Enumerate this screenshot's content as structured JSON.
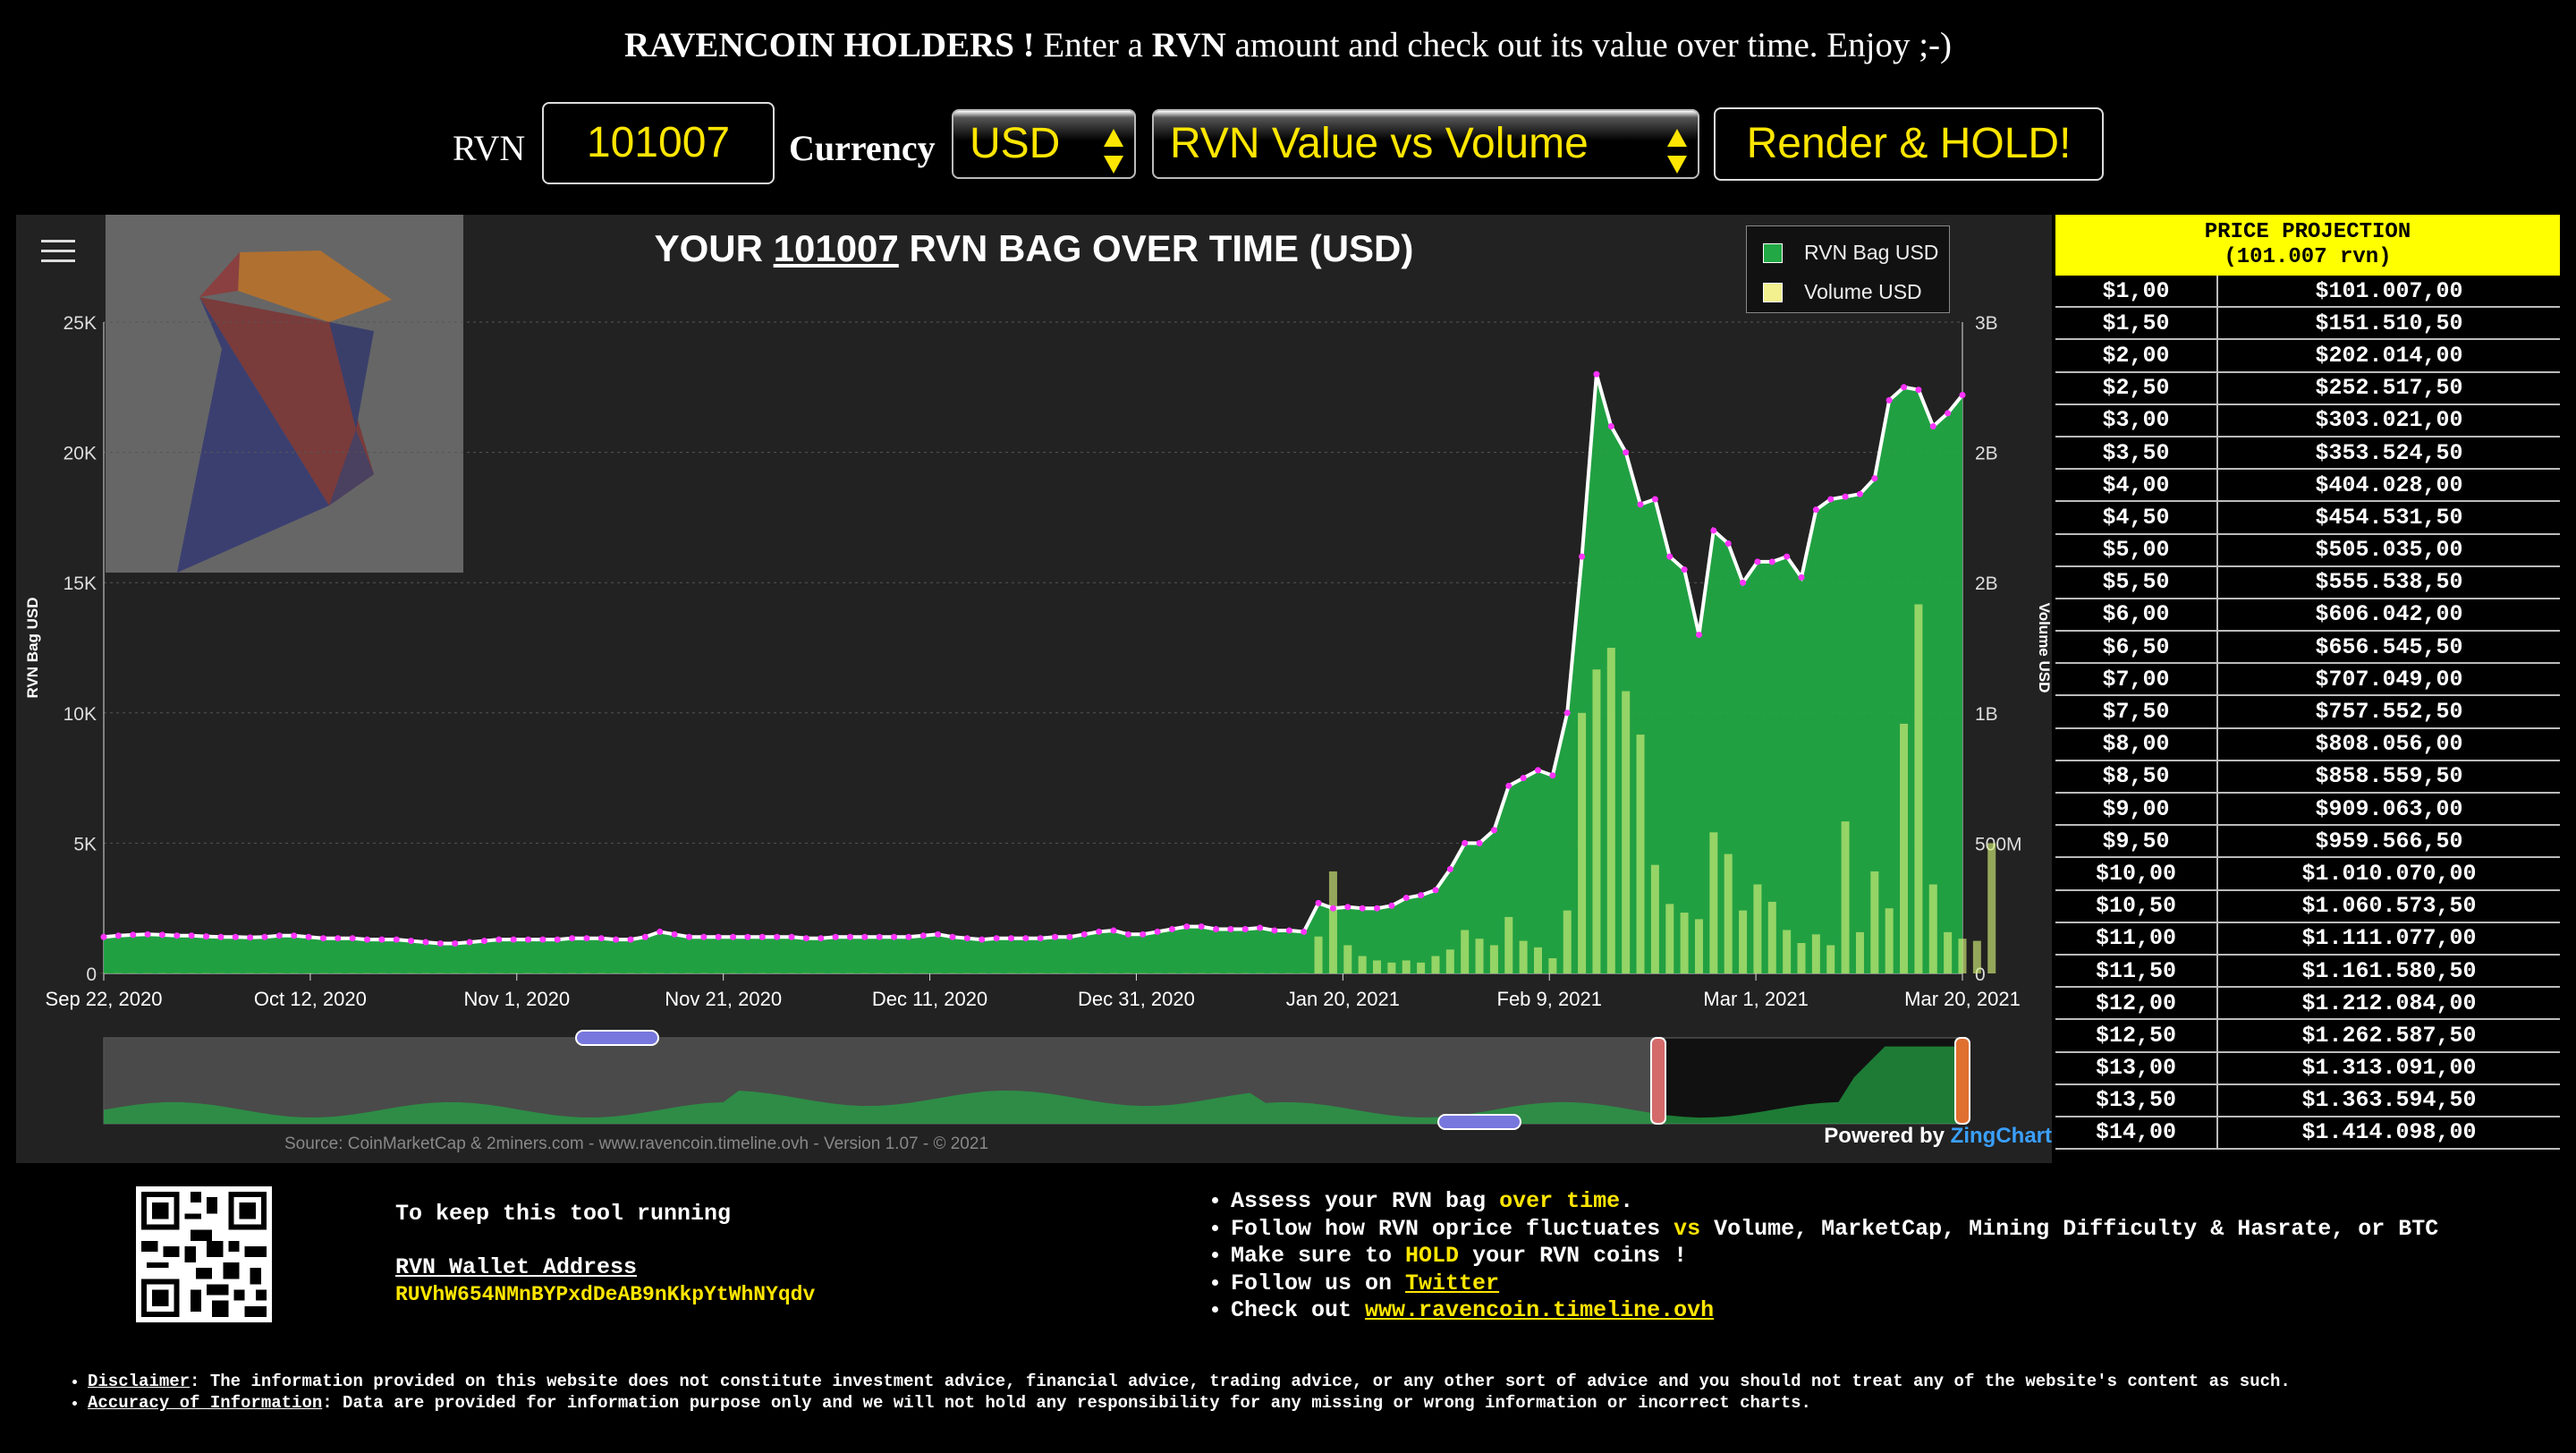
{
  "header": {
    "brand": "RAVENCOIN HOLDERS !",
    "text1": "Enter a",
    "rvn": "RVN",
    "text2": "amount and check out its value over time. Enjoy ;-)"
  },
  "controls": {
    "rvn_label": "RVN",
    "rvn_value": "101007",
    "currency_label": "Currency",
    "currency_value": "USD",
    "chart_value": "RVN Value vs Volume",
    "render_label": "Render & HOLD!"
  },
  "chart": {
    "title_pre": "YOUR",
    "title_amount": "101007",
    "title_post": "RVN BAG OVER TIME (USD)",
    "legend": [
      "RVN Bag USD",
      "Volume USD"
    ],
    "source": "Source: CoinMarketCap & 2miners.com - www.ravencoin.timeline.ovh - Version 1.07 - © 2021",
    "powered_pre": "Powered by",
    "powered_brand": "ZingChart",
    "ylabel": "RVN Bag USD",
    "y2label": "Volume USD",
    "yticks": [
      "0",
      "5K",
      "10K",
      "15K",
      "20K",
      "25K"
    ],
    "y2ticks": [
      "0",
      "500M",
      "1B",
      "2B",
      "2B",
      "3B"
    ],
    "xticks": [
      "Sep 22, 2020",
      "Oct 12, 2020",
      "Nov 1, 2020",
      "Nov 21, 2020",
      "Dec 11, 2020",
      "Dec 31, 2020",
      "Jan 20, 2021",
      "Feb 9, 2021",
      "Mar 1, 2021",
      "Mar 20, 2021"
    ],
    "colors": {
      "bag": "#22a845",
      "volume": "#d4f07a",
      "line": "#ffffff",
      "markers": "#ff33ff"
    }
  },
  "chart_data": {
    "type": "area",
    "title": "YOUR 101007 RVN BAG OVER TIME (USD)",
    "ylabel": "RVN Bag USD",
    "y2label": "Volume USD",
    "ylim": [
      0,
      25000
    ],
    "y2lim": [
      0,
      3000000000
    ],
    "x_start": "Sep 22, 2020",
    "x_end": "Mar 20, 2021",
    "series": [
      {
        "name": "RVN Bag USD",
        "values": [
          1400,
          1450,
          1480,
          1500,
          1480,
          1450,
          1450,
          1420,
          1400,
          1400,
          1380,
          1400,
          1450,
          1450,
          1400,
          1350,
          1350,
          1350,
          1300,
          1300,
          1300,
          1250,
          1200,
          1150,
          1150,
          1200,
          1250,
          1300,
          1300,
          1300,
          1300,
          1300,
          1350,
          1350,
          1350,
          1300,
          1300,
          1400,
          1600,
          1500,
          1400,
          1400,
          1400,
          1400,
          1400,
          1400,
          1400,
          1400,
          1350,
          1350,
          1400,
          1400,
          1400,
          1400,
          1400,
          1400,
          1450,
          1500,
          1400,
          1350,
          1300,
          1350,
          1350,
          1350,
          1350,
          1400,
          1400,
          1500,
          1600,
          1650,
          1500,
          1500,
          1600,
          1700,
          1800,
          1800,
          1700,
          1700,
          1700,
          1750,
          1650,
          1650,
          1600,
          2700,
          2500,
          2550,
          2500,
          2500,
          2600,
          2900,
          3000,
          3200,
          4000,
          5000,
          5000,
          5500,
          7200,
          7500,
          7800,
          7600,
          10000,
          16000,
          23000,
          21000,
          20000,
          18000,
          18200,
          16000,
          15500,
          13000,
          17000,
          16500,
          15000,
          15800,
          15800,
          16000,
          15200,
          17800,
          18200,
          18300,
          18400,
          19000,
          22000,
          22500,
          22400,
          21000,
          21500,
          22200
        ]
      },
      {
        "name": "Volume USD",
        "values": [
          1000000,
          1000000,
          1000000,
          1000000,
          1000000,
          1000000,
          1000000,
          1000000,
          1000000,
          1000000,
          1000000,
          1000000,
          1000000,
          1000000,
          1000000,
          1000000,
          1000000,
          1000000,
          1000000,
          1000000,
          1000000,
          1000000,
          1000000,
          1000000,
          1000000,
          1000000,
          1000000,
          1000000,
          1000000,
          1000000,
          1000000,
          1000000,
          1000000,
          1000000,
          1000000,
          1000000,
          1000000,
          1000000,
          1000000,
          1000000,
          1000000,
          1000000,
          1000000,
          1000000,
          1000000,
          1000000,
          1000000,
          1000000,
          1000000,
          1000000,
          1000000,
          1000000,
          1000000,
          1000000,
          1000000,
          1000000,
          1000000,
          1000000,
          1000000,
          1000000,
          1000000,
          1000000,
          1000000,
          1000000,
          1000000,
          1000000,
          1000000,
          1000000,
          1000000,
          1000000,
          1000000,
          1000000,
          1000000,
          1000000,
          1000000,
          1000000,
          1000000,
          1000000,
          1000000,
          1000000,
          1000000,
          1000000,
          1000000,
          170000000,
          470000000,
          130000000,
          80000000,
          60000000,
          50000000,
          60000000,
          50000000,
          80000000,
          110000000,
          200000000,
          160000000,
          130000000,
          260000000,
          150000000,
          120000000,
          70000000,
          290000000,
          1200000000,
          1400000000,
          1500000000,
          1300000000,
          1100000000,
          500000000,
          320000000,
          280000000,
          250000000,
          650000000,
          550000000,
          290000000,
          410000000,
          330000000,
          200000000,
          140000000,
          180000000,
          130000000,
          700000000,
          190000000,
          470000000,
          300000000,
          1150000000,
          1700000000,
          410000000,
          190000000,
          160000000,
          150000000,
          600000000
        ]
      }
    ]
  },
  "projection": {
    "title": "PRICE PROJECTION",
    "subtitle": "(101.007 rvn)",
    "rows": [
      [
        "$1,00",
        "$101.007,00"
      ],
      [
        "$1,50",
        "$151.510,50"
      ],
      [
        "$2,00",
        "$202.014,00"
      ],
      [
        "$2,50",
        "$252.517,50"
      ],
      [
        "$3,00",
        "$303.021,00"
      ],
      [
        "$3,50",
        "$353.524,50"
      ],
      [
        "$4,00",
        "$404.028,00"
      ],
      [
        "$4,50",
        "$454.531,50"
      ],
      [
        "$5,00",
        "$505.035,00"
      ],
      [
        "$5,50",
        "$555.538,50"
      ],
      [
        "$6,00",
        "$606.042,00"
      ],
      [
        "$6,50",
        "$656.545,50"
      ],
      [
        "$7,00",
        "$707.049,00"
      ],
      [
        "$7,50",
        "$757.552,50"
      ],
      [
        "$8,00",
        "$808.056,00"
      ],
      [
        "$8,50",
        "$858.559,50"
      ],
      [
        "$9,00",
        "$909.063,00"
      ],
      [
        "$9,50",
        "$959.566,50"
      ],
      [
        "$10,00",
        "$1.010.070,00"
      ],
      [
        "$10,50",
        "$1.060.573,50"
      ],
      [
        "$11,00",
        "$1.111.077,00"
      ],
      [
        "$11,50",
        "$1.161.580,50"
      ],
      [
        "$12,00",
        "$1.212.084,00"
      ],
      [
        "$12,50",
        "$1.262.587,50"
      ],
      [
        "$13,00",
        "$1.313.091,00"
      ],
      [
        "$13,50",
        "$1.363.594,50"
      ],
      [
        "$14,00",
        "$1.414.098,00"
      ]
    ]
  },
  "support": {
    "line1": "To keep this tool running",
    "addr_label": "RVN Wallet Address",
    "wallet": "RUVhW654NMnBYPxdDeAB9nKkpYtWhNYqdv"
  },
  "features": {
    "f1a": "Assess your RVN bag",
    "f1b": "over time",
    "f1c": ".",
    "f2a": "Follow how RVN oprice fluctuates",
    "f2b": "vs",
    "f2c": "Volume, MarketCap, Mining Difficulty & Hasrate, or BTC",
    "f3a": "Make sure to",
    "f3b": "HOLD",
    "f3c": "your RVN coins !",
    "f4a": "Follow us on",
    "f4b": "Twitter",
    "f5a": "Check out",
    "f5b": "www.ravencoin.timeline.ovh"
  },
  "disclaimer": {
    "d1a": "Disclaimer",
    "d1b": ": The information provided on this website does not constitute investment advice, financial advice, trading advice, or any other sort of advice and you should not treat any of the website's content as such.",
    "d2a": "Accuracy of Information",
    "d2b": ": Data are provided for information purpose only and we will not hold any responsibility for any missing or wrong information or incorrect charts."
  }
}
